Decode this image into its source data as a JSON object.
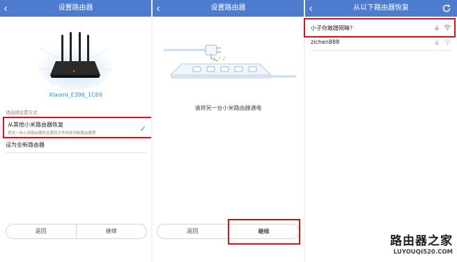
{
  "screen1": {
    "title": "设置路由器",
    "device_name": "Xiaomi_E396_1C69",
    "section_label": "请选择设置方式",
    "option_restore": {
      "title": "从其他小米路由器恢复",
      "description": "把另一台小米路由器的设置和文件恢复到新路由器里"
    },
    "option_new": "设为全新路由器",
    "buttons": {
      "back": "返回",
      "continue": "继续"
    }
  },
  "screen2": {
    "title": "设置路由器",
    "hint": "请将另一台小米路由器通电",
    "buttons": {
      "back": "返回",
      "continue": "继续"
    }
  },
  "screen3": {
    "title": "从以下路由器恢复",
    "networks": [
      {
        "ssid": "小子你敢蹭网嘛?",
        "secured": true,
        "signal": "strong"
      },
      {
        "ssid": "zichen888",
        "secured": true,
        "signal": "weak"
      }
    ]
  },
  "watermark": {
    "text": "路由器之家",
    "url": "LUYOUQI520.COM"
  },
  "colors": {
    "header": "#4d7ccf",
    "accent": "#2f8cd8",
    "highlight_box": "#d7111b"
  },
  "icons": {
    "back": "chevron-left-icon",
    "refresh": "refresh-icon",
    "check": "check-icon",
    "lock": "lock-icon",
    "wifi": "wifi-icon"
  }
}
